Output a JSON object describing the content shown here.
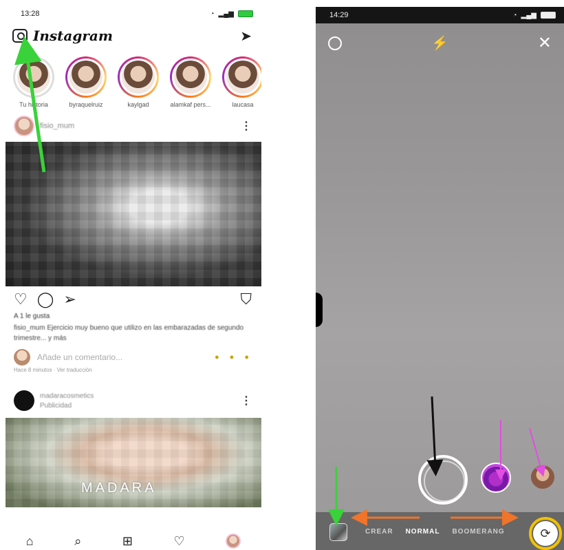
{
  "left": {
    "status_time": "13:28",
    "app_name": "Instagram",
    "stories": [
      {
        "name": "Tu historia"
      },
      {
        "name": "byraquelruiz"
      },
      {
        "name": "kaylgad"
      },
      {
        "name": "alamkaf pers..."
      },
      {
        "name": "laucasa"
      }
    ],
    "post1": {
      "username": "fisio_mum",
      "likes": "A 1 le gusta",
      "caption": "fisio_mum Ejercicio muy bueno que utilizo en las embarazadas de segundo trimestre... y más",
      "comment_placeholder": "Añade un comentario...",
      "time": "Hace 8 minutos · Ver traducción"
    },
    "post2": {
      "username": "madaracosmetics",
      "subtitle": "Publicidad",
      "brand": "MADARA"
    }
  },
  "right": {
    "status_time": "14:29",
    "modes": [
      "CREAR",
      "NORMAL",
      "BOOMERANG"
    ],
    "active_mode": "NORMAL"
  },
  "colors": {
    "green_arrow": "#39d23a",
    "black_arrow": "#111111",
    "orange_arrow": "#f0742a",
    "magenta_arrow": "#e04fe0",
    "yellow_ring": "#f2c200"
  },
  "icons": [
    "camera-icon",
    "send-icon",
    "settings-icon",
    "flash-off-icon",
    "close-icon",
    "flip-camera-icon",
    "heart-icon",
    "comment-icon",
    "share-icon",
    "bookmark-icon",
    "home-icon",
    "search-icon",
    "add-icon",
    "activity-icon"
  ]
}
